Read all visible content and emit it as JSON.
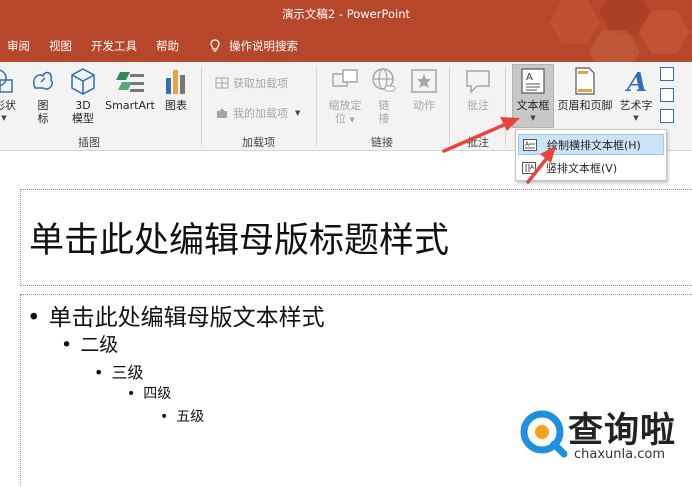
{
  "window": {
    "title": "演示文稿2  -  PowerPoint"
  },
  "tabs": [
    "审阅",
    "视图",
    "开发工具",
    "帮助"
  ],
  "tell_me": "操作说明搜索",
  "ribbon": {
    "illustrations": {
      "shapes": "形状",
      "icons_line1": "图",
      "icons_line2": "标",
      "model3d_line1": "3D",
      "model3d_line2": "模型",
      "smartart": "SmartArt",
      "chart": "图表",
      "group": "插图"
    },
    "addins": {
      "get": "获取加载项",
      "mine": "我的加载项",
      "group": "加载项"
    },
    "links": {
      "zoom_line1": "缩放定",
      "zoom_line2": "位",
      "link_line1": "链",
      "link_line2": "接",
      "action": "动作",
      "group": "链接"
    },
    "comments": {
      "comment": "批注",
      "group": "批注"
    },
    "text": {
      "textbox": "文本框",
      "header_footer": "页眉和页脚",
      "wordart": "艺术字"
    }
  },
  "dropdown": {
    "horizontal": "绘制横排文本框(H)",
    "vertical": "竖排文本框(V)"
  },
  "slide": {
    "title_placeholder": "单击此处编辑母版标题样式",
    "levels": [
      "单击此处编辑母版文本样式",
      "二级",
      "三级",
      "四级",
      "五级"
    ]
  },
  "watermark": {
    "name": "查询啦",
    "url": "chaxunla.com"
  },
  "colors": {
    "accent": "#b7472a",
    "highlight": "#cde3f7",
    "arrow": "#e8463c",
    "watermark_blue": "#1e8fe1",
    "watermark_orange": "#f4a21e"
  }
}
